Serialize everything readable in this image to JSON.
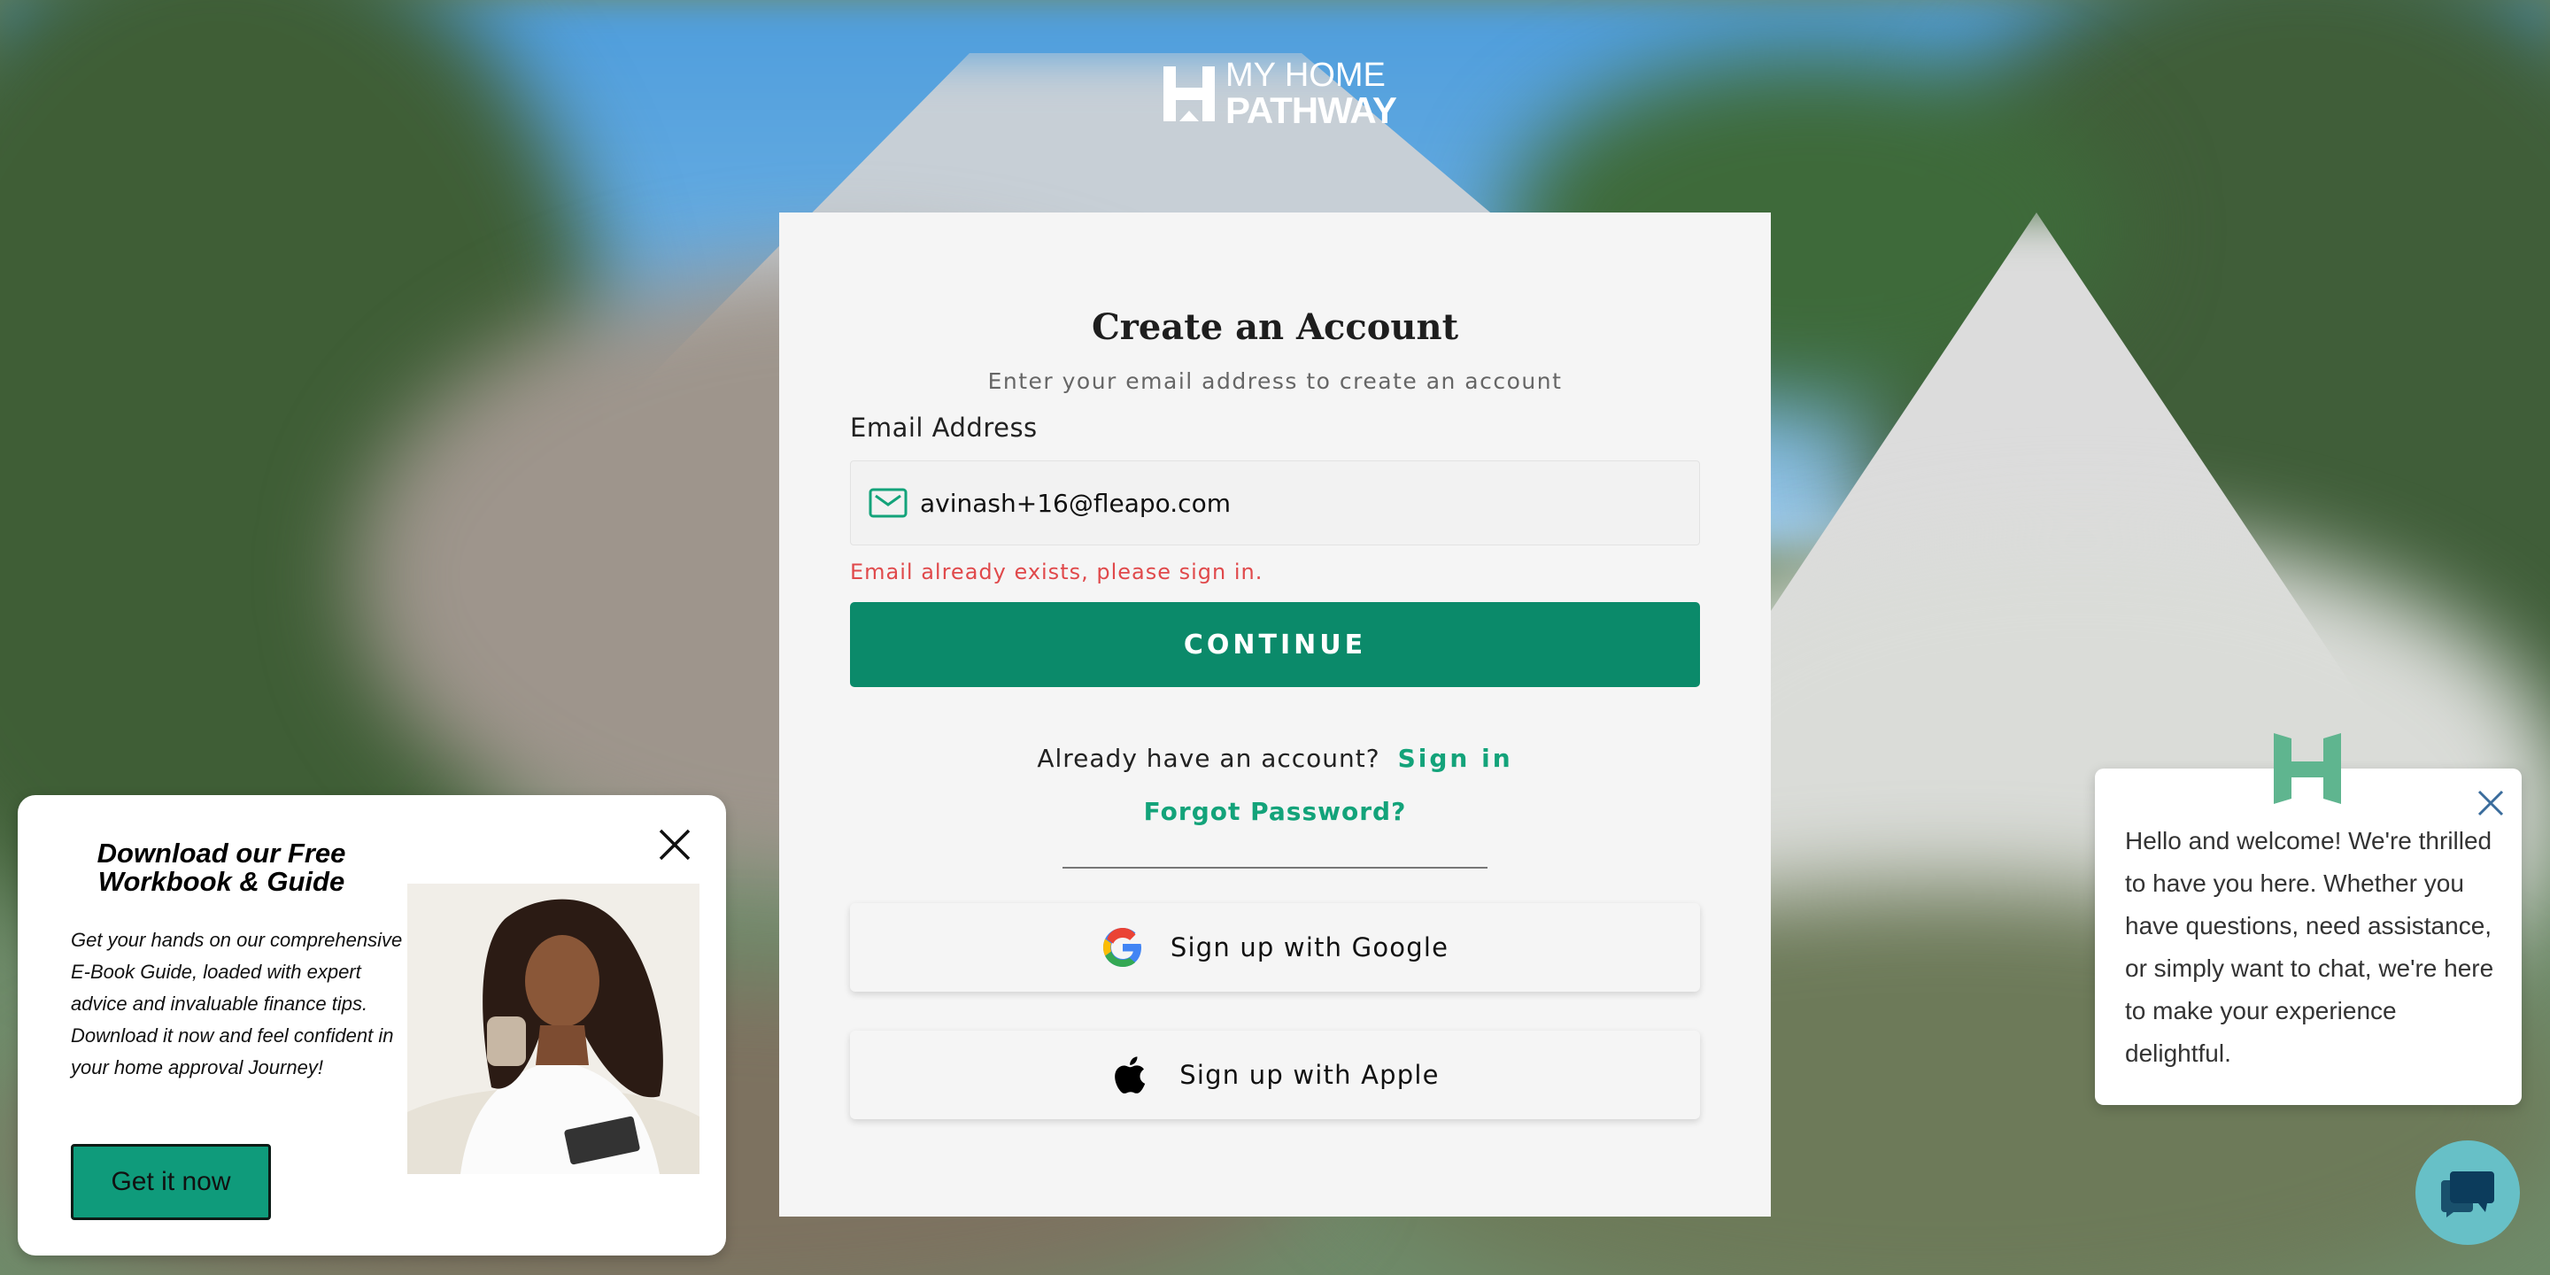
{
  "logo": {
    "line1": "MY HOME",
    "line2": "PATHWAY"
  },
  "form": {
    "title": "Create an Account",
    "subtitle": "Enter your email address to create an account",
    "email_label": "Email Address",
    "email_value": "avinash+16@fleapo.com",
    "error": "Email already exists, please sign in.",
    "continue_label": "CONTINUE",
    "already_text": "Already have an account?",
    "sign_in_label": "Sign in",
    "forgot_label": "Forgot Password?",
    "google_label": "Sign up with Google",
    "apple_label": "Sign up with Apple"
  },
  "promo": {
    "title": "Download our Free Workbook & Guide",
    "body": "Get your hands on our comprehensive E-Book Guide, loaded with expert advice and invaluable finance tips. Download it now and feel confident in your home approval  Journey!",
    "button_label": "Get it now"
  },
  "chat": {
    "message": "Hello and welcome! We're thrilled to have you here. Whether you have questions, need assistance, or simply want to chat, we're here to make your experience delightful."
  },
  "colors": {
    "brand_green": "#0b8a6a",
    "link_green": "#13a37a",
    "error_red": "#e0494b",
    "chat_teal": "#67c0c7"
  },
  "icons": [
    "mail-icon",
    "google-icon",
    "apple-icon",
    "close-icon",
    "chat-icon",
    "home-logo-icon"
  ]
}
